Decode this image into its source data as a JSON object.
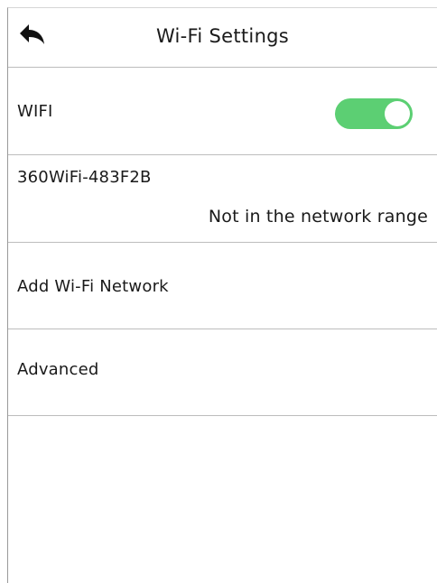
{
  "header": {
    "title": "Wi-Fi Settings",
    "back_icon": "back-arrow-icon"
  },
  "wifi": {
    "label": "WIFI",
    "enabled": true,
    "toggle_color": "#5ccf73"
  },
  "network": {
    "name": "360WiFi-483F2B",
    "status": "Not in the network range"
  },
  "menu": {
    "add_label": "Add Wi-Fi Network",
    "advanced_label": "Advanced"
  }
}
